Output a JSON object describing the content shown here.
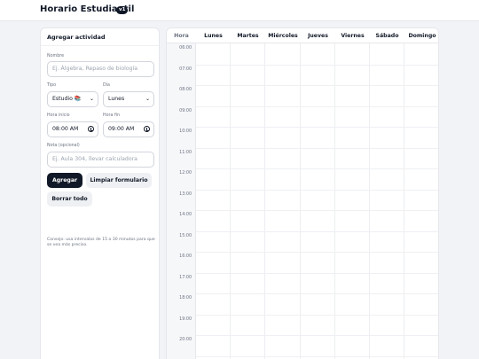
{
  "app": {
    "title": "Horario Estudiantil",
    "version": "v1"
  },
  "form": {
    "header": "Agregar actividad",
    "name": {
      "label": "Nombre",
      "placeholder": "Ej. Álgebra, Repaso de biología",
      "value": ""
    },
    "type": {
      "label": "Tipo",
      "value": "Estudio 📚"
    },
    "day": {
      "label": "Día",
      "value": "Lunes"
    },
    "start": {
      "label": "Hora inicio",
      "value": "08:00 AM"
    },
    "end": {
      "label": "Hora fin",
      "value": "09:00 AM"
    },
    "note": {
      "label": "Nota (opcional)",
      "placeholder": "Ej. Aula 304, llevar calculadora",
      "value": ""
    },
    "buttons": {
      "add": "Agregar",
      "clear": "Limpiar formulario",
      "delete_all": "Borrar todo"
    },
    "hint": "Consejo: usa intervalos de 15 o 30 minutos para que se vea más preciso."
  },
  "schedule": {
    "hour_header": "Hora",
    "days": [
      "Lunes",
      "Martes",
      "Miércoles",
      "Jueves",
      "Viernes",
      "Sábado",
      "Domingo"
    ],
    "hours": [
      "06:00",
      "07:00",
      "08:00",
      "09:00",
      "10:00",
      "11:00",
      "12:00",
      "13:00",
      "14:00",
      "15:00",
      "16:00",
      "17:00",
      "18:00",
      "19:00",
      "20:00"
    ]
  },
  "colors": {
    "primary": "#111827",
    "background": "#f1f3f7",
    "border": "#e5e7eb"
  }
}
